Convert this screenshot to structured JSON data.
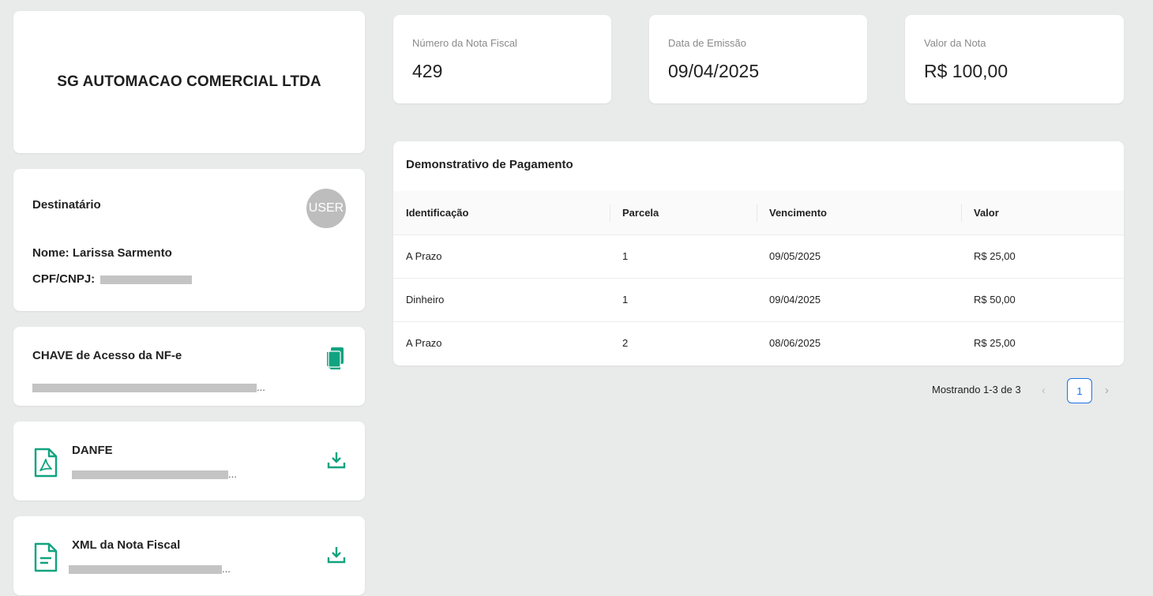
{
  "company": {
    "name": "SG AUTOMACAO COMERCIAL LTDA"
  },
  "recipient": {
    "title": "Destinatário",
    "avatar_text": "USER",
    "name_label": "Nome: Larissa Sarmento",
    "doc_label": "CPF/CNPJ:"
  },
  "access_key": {
    "title": "CHAVE de Acesso da NF-e",
    "value_suffix": "..."
  },
  "danfe": {
    "title": "DANFE",
    "value_suffix": "..."
  },
  "xml": {
    "title": "XML da Nota Fiscal",
    "value_suffix": "..."
  },
  "stats": {
    "number": {
      "label": "Número da Nota Fiscal",
      "value": "429"
    },
    "date": {
      "label": "Data de Emissão",
      "value": "09/04/2025"
    },
    "amount": {
      "label": "Valor da Nota",
      "value": "R$ 100,00"
    }
  },
  "payments": {
    "title": "Demonstrativo de Pagamento",
    "headers": [
      "Identificação",
      "Parcela",
      "Vencimento",
      "Valor"
    ],
    "rows": [
      [
        "A Prazo",
        "1",
        "09/05/2025",
        "R$ 25,00"
      ],
      [
        "Dinheiro",
        "1",
        "09/04/2025",
        "R$ 50,00"
      ],
      [
        "A Prazo",
        "2",
        "08/06/2025",
        "R$ 25,00"
      ]
    ]
  },
  "pagination": {
    "info": "Mostrando 1-3 de 3",
    "current": "1",
    "prev": "‹",
    "next": "›"
  },
  "colors": {
    "accent": "#11a37f",
    "page_bg": "#e9eaea",
    "pager_active": "#1a73e8"
  },
  "icons": {
    "copy": "copy-icon",
    "pdf": "pdf-file-icon",
    "xml": "document-icon",
    "download": "download-icon"
  }
}
